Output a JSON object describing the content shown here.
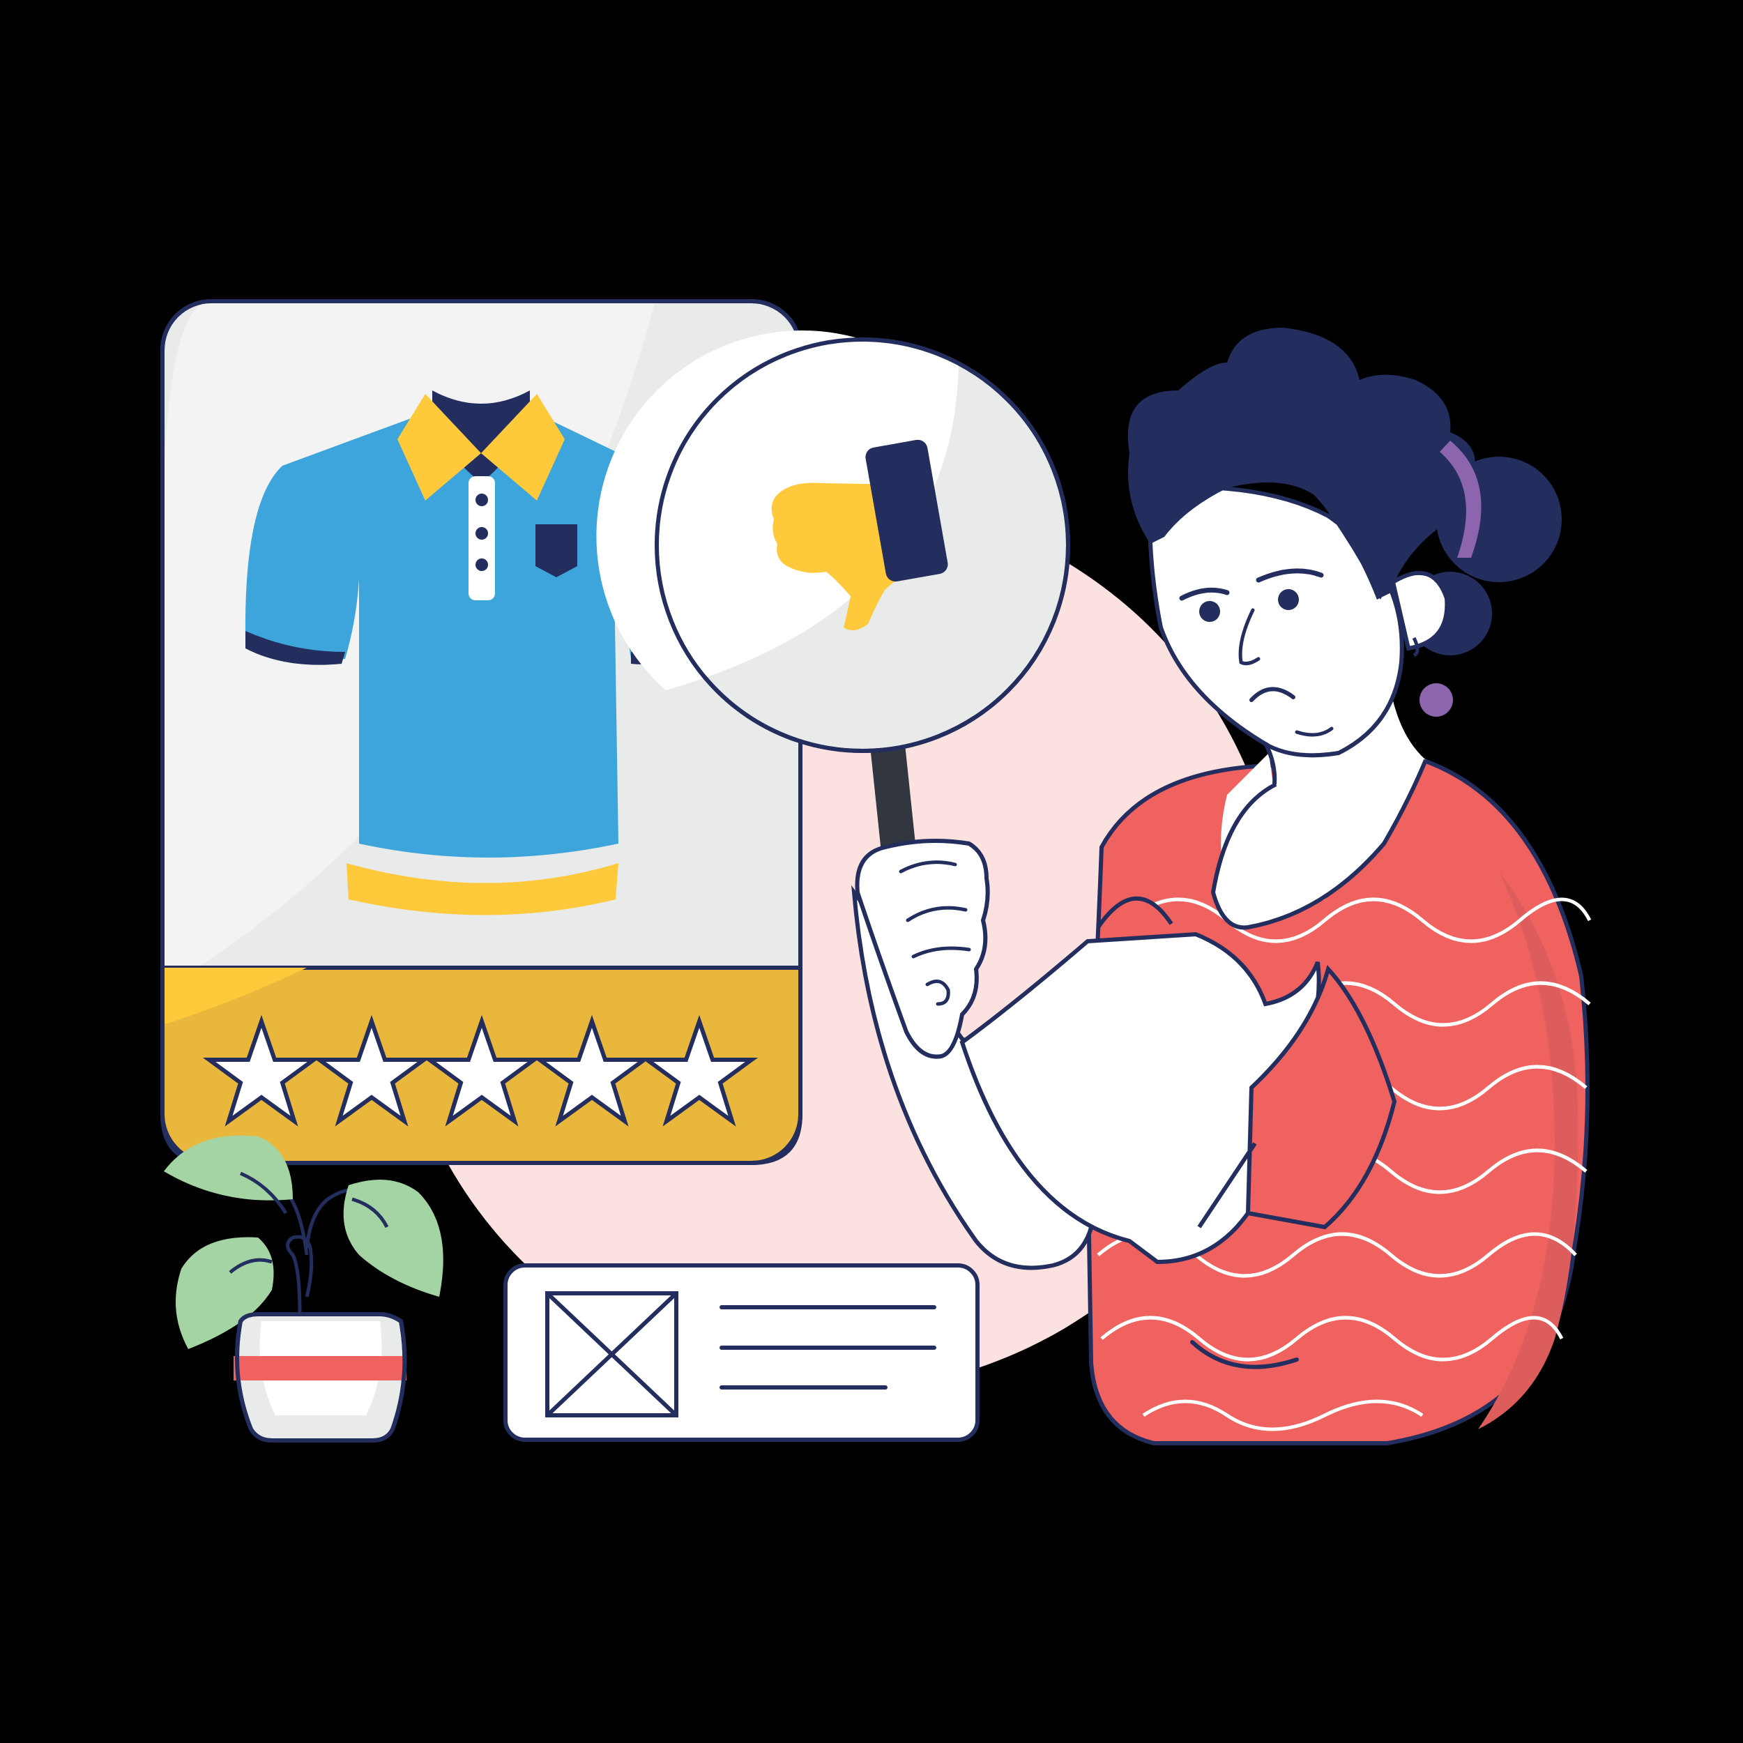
{
  "scene": {
    "background_color": "#000000",
    "outline_color": "#232E5E",
    "accent_pink": "#FCE1E1",
    "card_gray": "#E9EAEA",
    "shirt_blue": "#3DA5DB",
    "collar_yellow": "#FEC93A",
    "rating_bar_yellow": "#E9B73C",
    "shirt_red": "#EF625F",
    "hair_navy": "#232E5E",
    "earring_purple": "#8D64AE",
    "leaf_green": "#A5D4A4"
  },
  "product_card": {
    "product_icon": "polo-shirt-icon",
    "rating": {
      "stars_total": 5,
      "star_icon": "star-outline-icon"
    }
  },
  "sign": {
    "icon": "thumbs-down-icon"
  },
  "review_card": {
    "image_icon": "image-placeholder-icon",
    "text_lines": 3
  },
  "plant": {
    "icon": "potted-plant-icon"
  },
  "person": {
    "expression": "displeased"
  }
}
